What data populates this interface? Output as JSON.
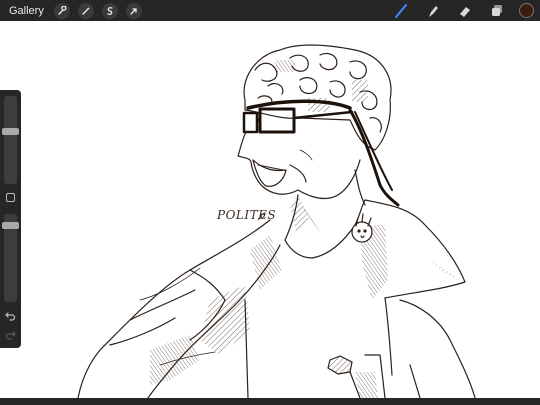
{
  "topbar": {
    "gallery_label": "Gallery",
    "tools_left": [
      "wrench-icon",
      "magic-wand-icon",
      "selection-icon",
      "transform-arrow-icon"
    ],
    "tools_right": [
      "brush-icon",
      "smudge-icon",
      "eraser-icon",
      "layers-icon"
    ],
    "active_tool": "brush-icon",
    "accent_color": "#3d8cff",
    "current_color": "#3a1d0c"
  },
  "sidebar": {
    "brush_size_level": 0.6,
    "opacity_level": 0.9,
    "buttons": [
      "modify-icon",
      "undo-icon",
      "redo-icon"
    ]
  },
  "canvas": {
    "signature": "POLITES"
  }
}
